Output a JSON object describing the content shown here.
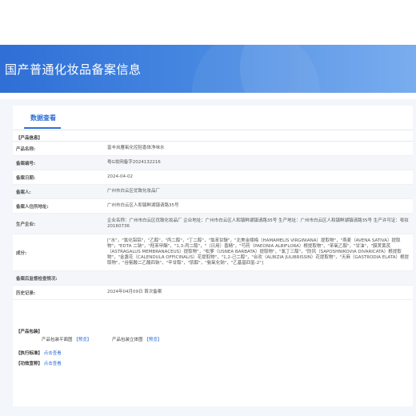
{
  "banner": {
    "title": "国产普通化妆品备案信息"
  },
  "tabs": [
    {
      "label": "数据查看"
    }
  ],
  "product_info": {
    "section_title": "【产品信息】",
    "rows": [
      {
        "label": "产品名称:",
        "value": "富丰岚雁氧化控稻香体净味水"
      },
      {
        "label": "备案编号:",
        "value": "粤G妆网备字2024132216"
      },
      {
        "label": "备案日期:",
        "value": "2024-04-02"
      },
      {
        "label": "备案人:",
        "value": "广州市白云区优致化妆品厂"
      },
      {
        "label": "备案人住所地址:",
        "value": "广州市白云区人和镇鲜湖镇请路35号"
      },
      {
        "label": "生产企业:",
        "value": "企业名称：广州市白云区优致化妆品厂 企业地址：广州市白云区人和镇鲜湖镇请路35号 生产地址：广州市白云区人和镇鲜湖镇请路35号 生产许可证：粤妆20160736"
      },
      {
        "label": "成分:",
        "value": "[\"水\"，\"氯化铝铝\"，\"乙醇\"，\"丙二醇\"，\"丁二醇\"，\"氯苯甘醚\"，\"北美金缕梅（HAMAMELIS VIRGINIANA）提取物\"，\"燕麦（AVENA SATIVA）提取物\"，\"EDTA 二钠\"，\"羟苯甲酯\"，\"1,3-丙二醇\"，\"（日用）香精\"，\"芍药（PAEONIA ALBIFLORA）根提取物\"，\"苯氧乙醇\"，\"甘油\"，\"膜荚黄芪（ASTRAGALUS MEMBRANACEUS）提取物\"，\"松萝（USNEA BARBATA）提取物\"，\"氯丁三醇\"，\"防风（SAPOSHNIKOVIA DIVARICATA）根提取物\"，\"金盏花（CALENDULA OFFICINALIS）花提取物\"，\"1,2-己二醇\"，\"合欢（ALBIZIA JULIBRISSIN）花提取物\"，\"天麻（GASTRODIA ELATA）根提取物\"，\"谷氨酸二乙酸四钠\"，\"辛甘醇\"，\"肌醇\"，\"氨氧化钠\"，\"乙基基四氢-2\"]"
      },
      {
        "label": "备案后监督检查情况:",
        "value": ""
      },
      {
        "label": "历史记录:",
        "value": "2024年04月09日 首次备案"
      }
    ]
  },
  "package": {
    "section_title": "【产品包装】",
    "plan_label": "产品包装平面图",
    "plan_link": "【预览】",
    "solid_label": "产品包装立体图",
    "solid_link": "【预览】"
  },
  "standard": {
    "section_title": "【执行标准】",
    "link": "点击查看"
  },
  "claim": {
    "section_title": "【功效宣称】",
    "link": "点击查看"
  }
}
